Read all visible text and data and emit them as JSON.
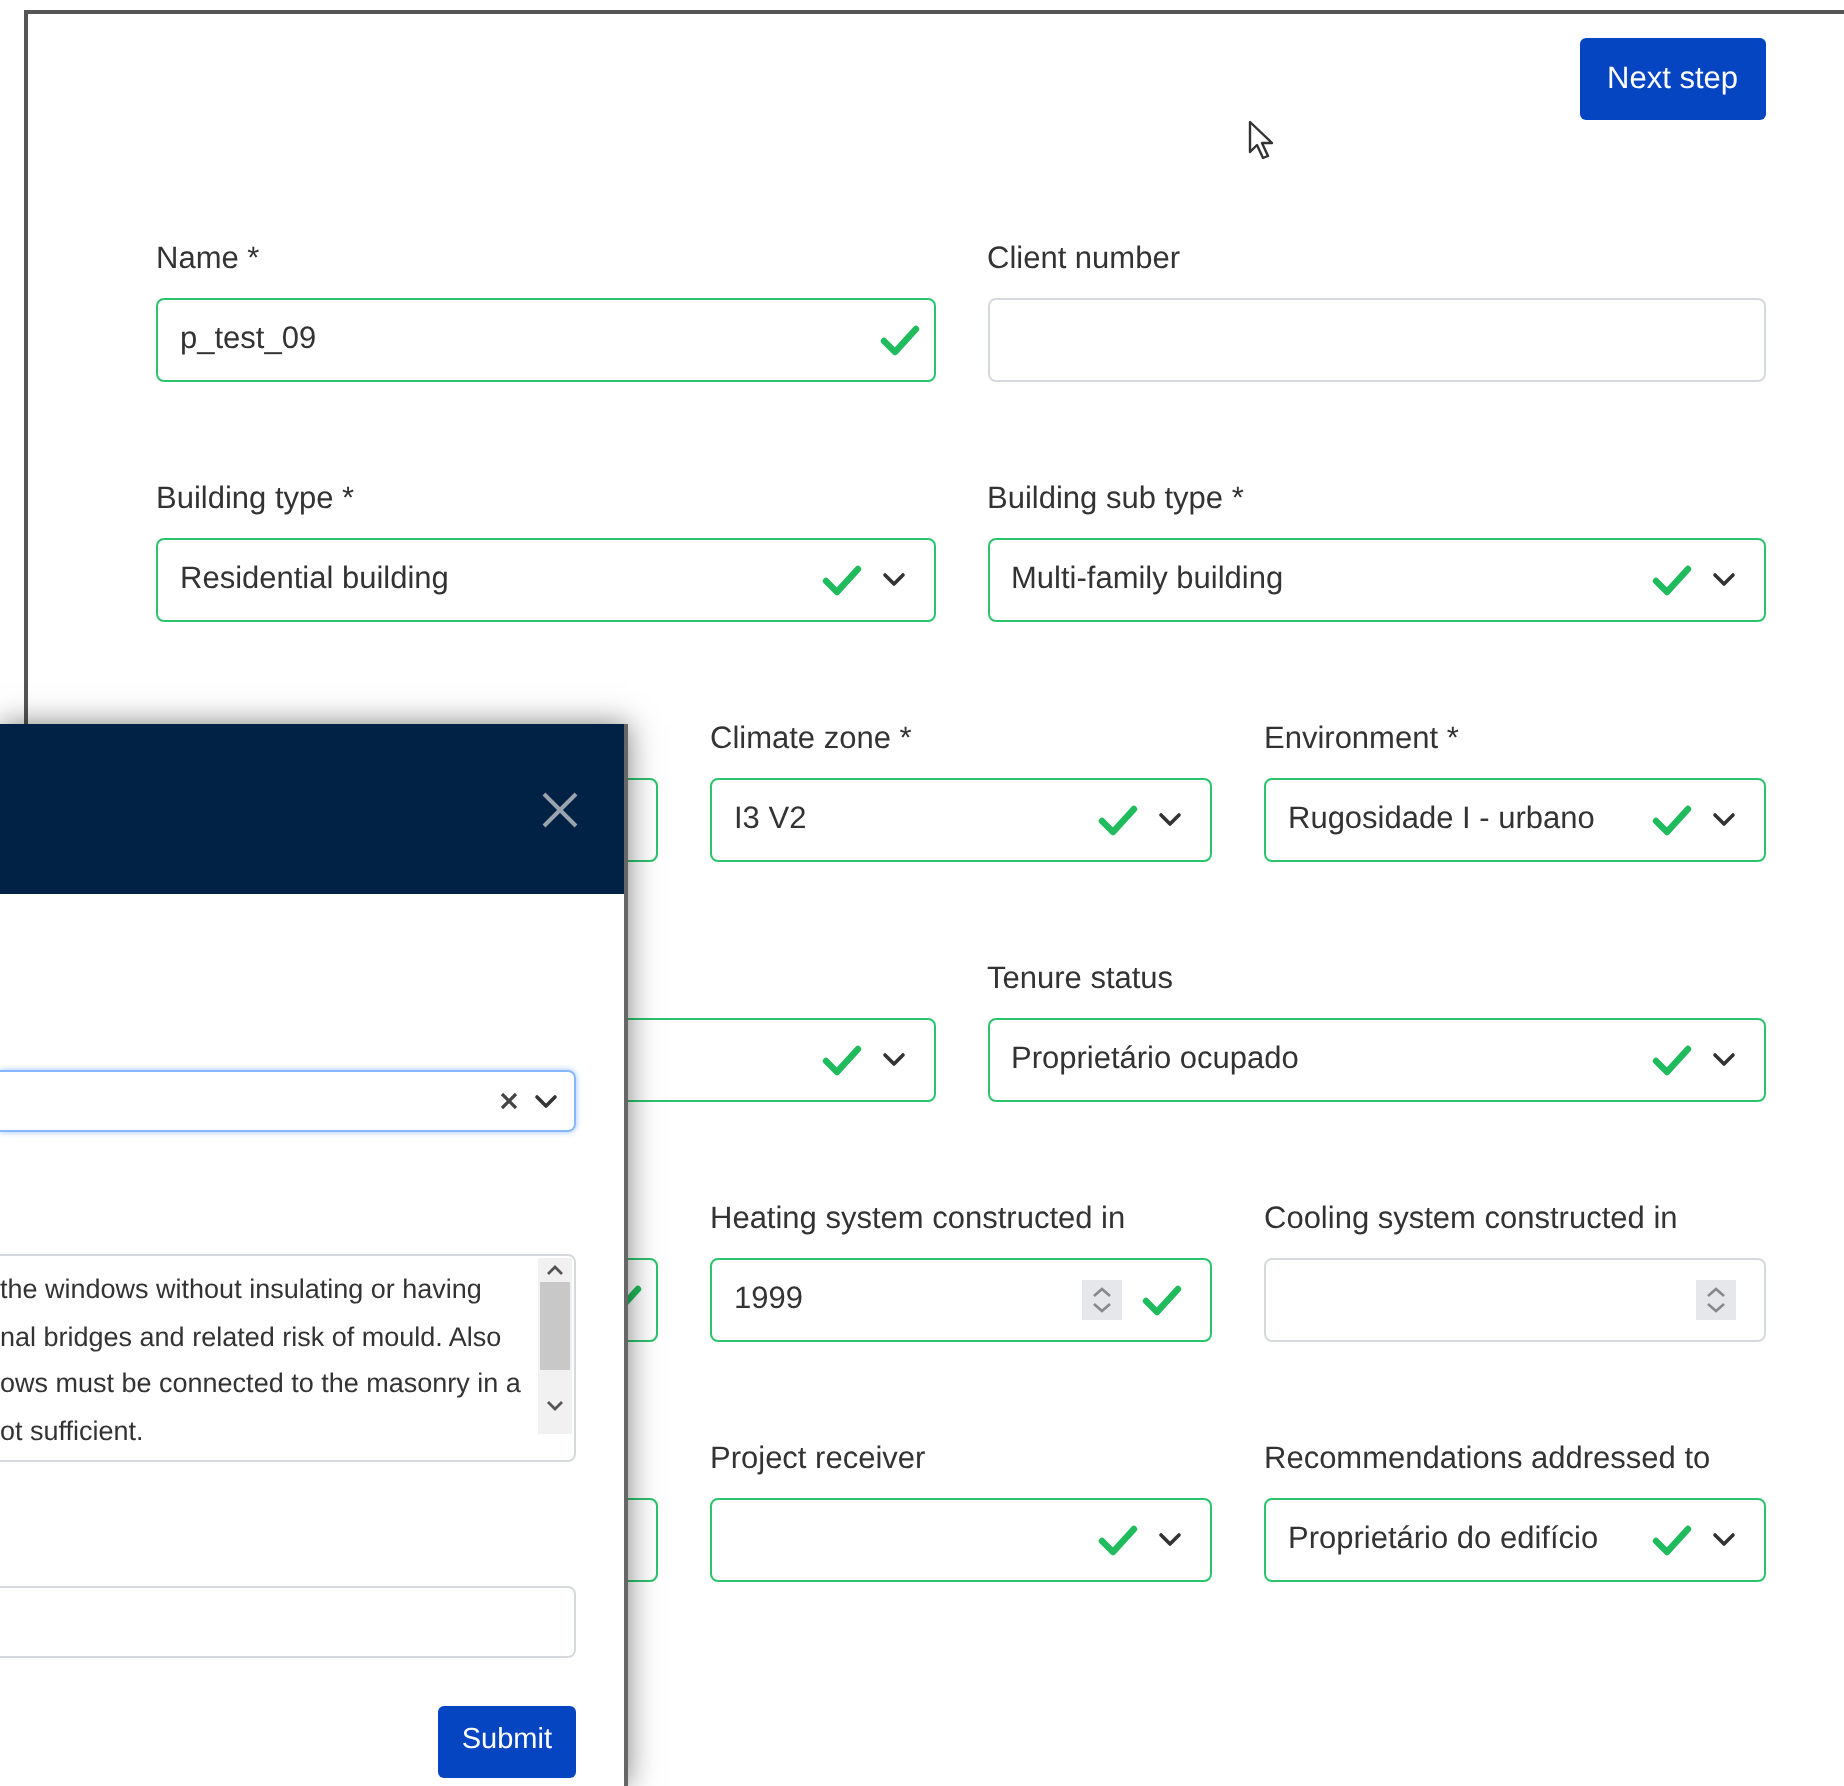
{
  "next_button": "Next step",
  "form_rows": [
    {
      "fields": [
        {
          "label": "Name *",
          "kind": "text",
          "value": "p_test_09",
          "valid": true,
          "check": true
        },
        {
          "label": "Client number",
          "kind": "text",
          "valid": false,
          "check": false
        }
      ]
    },
    {
      "fields": [
        {
          "label": "Building type *",
          "kind": "select",
          "value": "Residential building",
          "valid": true,
          "check": true
        },
        {
          "label": "Building sub type *",
          "kind": "select",
          "value": "Multi-family building",
          "valid": true,
          "check": true
        }
      ]
    },
    {
      "fields": [
        {
          "kind": "text",
          "valid": true,
          "check": false
        },
        {
          "label": "Climate zone *",
          "kind": "select",
          "value": "I3 V2",
          "valid": true,
          "check": true
        },
        {
          "label": "Environment *",
          "kind": "select",
          "value": "Rugosidade I - urbano",
          "valid": true,
          "check": true
        }
      ]
    },
    {
      "fields": [
        {
          "kind": "select",
          "valid": true,
          "check": true
        },
        {
          "label": "Tenure status",
          "kind": "select",
          "value": "Proprietário ocupado",
          "valid": true,
          "check": true
        }
      ]
    },
    {
      "fields": [
        {
          "kind": "text",
          "valid": true,
          "check": true
        },
        {
          "label": "Heating system constructed in",
          "kind": "number",
          "value": "1999",
          "valid": true,
          "check": true
        },
        {
          "label": "Cooling system constructed in",
          "kind": "number",
          "valid": false,
          "check": false
        }
      ]
    },
    {
      "fields": [
        {
          "kind": "text",
          "valid": true,
          "check": false
        },
        {
          "label": "Project receiver",
          "kind": "select",
          "valid": true,
          "check": true
        },
        {
          "label": "Recommendations addressed to",
          "kind": "select",
          "value": "Proprietário do edifício",
          "valid": true,
          "check": true
        }
      ]
    }
  ],
  "modal": {
    "textarea_lines": [
      "the windows without insulating or having",
      "nal bridges and related risk of mould. Also",
      "ows must be connected to the masonry in a",
      "ot sufficient."
    ],
    "submit": "Submit"
  }
}
